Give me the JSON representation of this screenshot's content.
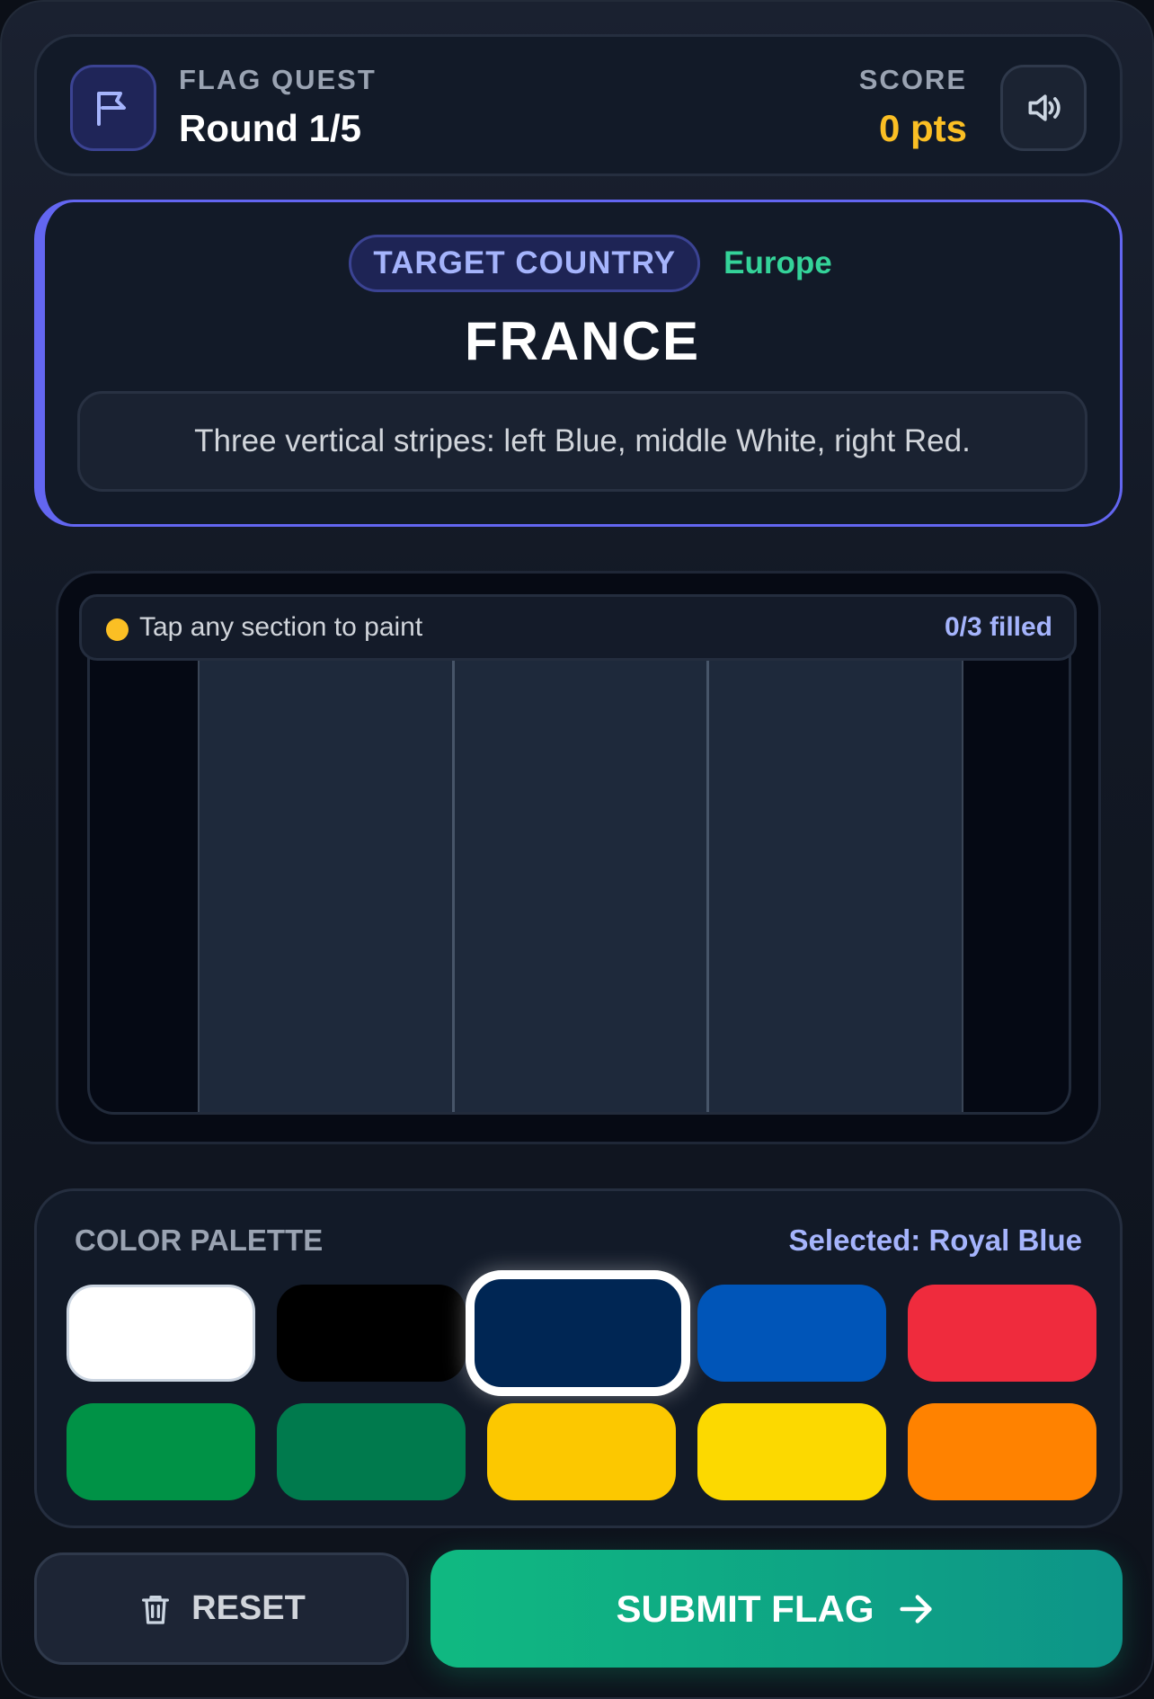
{
  "header": {
    "game_title": "FLAG QUEST",
    "round": "Round 1/5",
    "score_label": "SCORE",
    "score_value": "0 pts"
  },
  "target": {
    "chip_label": "TARGET COUNTRY",
    "region": "Europe",
    "country": "FRANCE",
    "hint": "Three vertical stripes: left Blue, middle White, right Red."
  },
  "canvas": {
    "status": "Tap any section to paint",
    "filled": "0/3 filled",
    "sections": [
      {
        "name": "left-stripe",
        "color": "#1e293b"
      },
      {
        "name": "middle-stripe",
        "color": "#1e293b"
      },
      {
        "name": "right-stripe",
        "color": "#1e293b"
      }
    ]
  },
  "palette": {
    "title": "COLOR PALETTE",
    "selected": "Selected: Royal Blue",
    "swatches": [
      {
        "color": "#ffffff"
      },
      {
        "color": "#000000"
      },
      {
        "color": "#002654"
      },
      {
        "color": "#0055b8"
      },
      {
        "color": "#ef2b3d"
      },
      {
        "color": "#009246"
      },
      {
        "color": "#007a4d"
      },
      {
        "color": "#fcc800"
      },
      {
        "color": "#fcd900"
      },
      {
        "color": "#ff8200"
      }
    ]
  },
  "actions": {
    "reset": "RESET",
    "submit": "SUBMIT FLAG"
  },
  "icons": {
    "flag": "flag-icon",
    "sound": "speaker-icon",
    "reset": "trash-icon",
    "submit": "arrow-right-icon"
  }
}
